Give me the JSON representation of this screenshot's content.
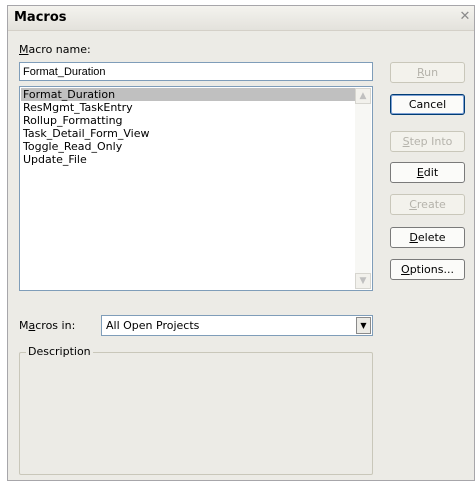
{
  "dialog": {
    "title": "Macros",
    "close_glyph": "✕"
  },
  "macro_name": {
    "label_mnemonic": "M",
    "label_rest": "acro name:",
    "value": "Format_Duration"
  },
  "macro_list": {
    "items": [
      {
        "label": "Format_Duration",
        "selected": true
      },
      {
        "label": "ResMgmt_TaskEntry",
        "selected": false
      },
      {
        "label": "Rollup_Formatting",
        "selected": false
      },
      {
        "label": "Task_Detail_Form_View",
        "selected": false
      },
      {
        "label": "Toggle_Read_Only",
        "selected": false
      },
      {
        "label": "Update_File",
        "selected": false
      }
    ],
    "scroll_up_icon": "▲",
    "scroll_down_icon": "▼"
  },
  "buttons": {
    "run": {
      "mnemonic": "R",
      "rest": "un",
      "enabled": false
    },
    "cancel": {
      "label": "Cancel",
      "enabled": true
    },
    "step_into": {
      "mnemonic": "S",
      "rest": "tep Into",
      "enabled": false
    },
    "edit": {
      "mnemonic": "E",
      "rest": "dit",
      "enabled": true
    },
    "create": {
      "mnemonic": "C",
      "rest": "reate",
      "enabled": false
    },
    "delete": {
      "mnemonic": "D",
      "rest": "elete",
      "enabled": true
    },
    "options": {
      "mnemonic": "O",
      "rest": "ptions...",
      "enabled": true
    }
  },
  "macros_in": {
    "label_pre": "M",
    "label_mnemonic": "a",
    "label_post": "cros in:",
    "selected": "All Open Projects",
    "arrow_icon": "▼"
  },
  "description": {
    "title": "Description",
    "text": ""
  },
  "colors": {
    "dialog_bg": "#ecebe6",
    "selection_bg": "#c0c0c0",
    "input_border": "#7f9db9",
    "disabled_text": "#b5b3ab"
  }
}
